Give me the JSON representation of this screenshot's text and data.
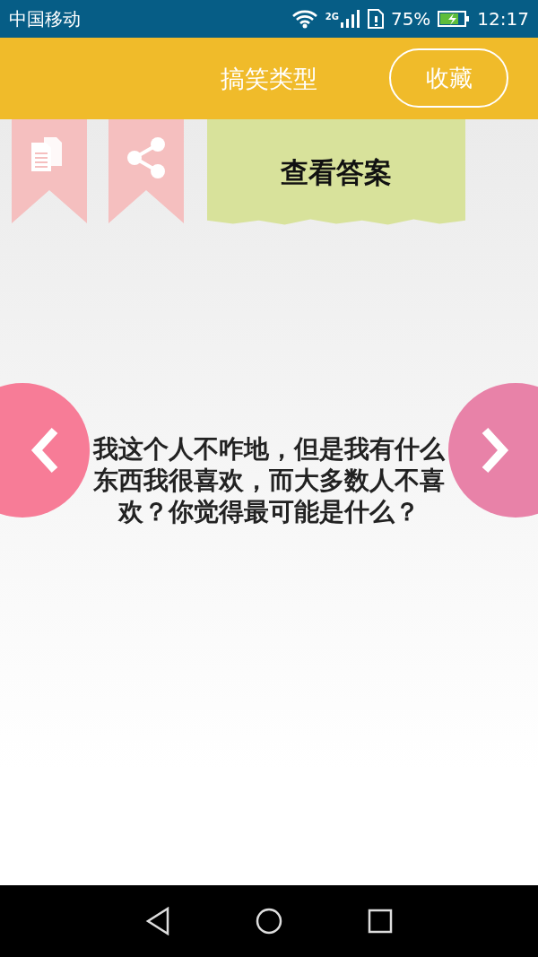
{
  "status_bar": {
    "carrier": "中国移动",
    "network": "2G",
    "battery": "75%",
    "time": "12:17"
  },
  "app_bar": {
    "title": "搞笑类型",
    "favorite_button": "收藏"
  },
  "answer_button": "查看答案",
  "question": "我这个人不咋地，但是我有什么东西我很喜欢，而大多数人不喜欢？你觉得最可能是什么？"
}
